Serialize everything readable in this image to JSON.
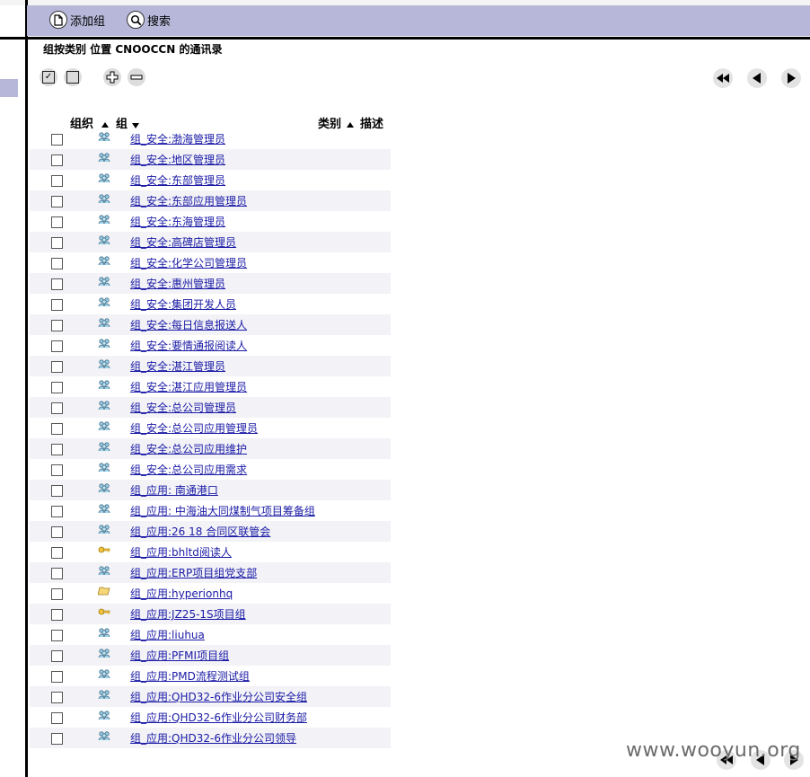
{
  "toolbar": {
    "add_group_label": "添加组",
    "search_label": "搜索"
  },
  "heading": "组按类别 位置 CNOOCCN 的通讯录",
  "columns": {
    "org": "组织",
    "group": "组",
    "category": "类别",
    "desc": "描述"
  },
  "rows": [
    {
      "label": "组_安全:渤海管理员",
      "icon": "group-icon"
    },
    {
      "label": "组_安全:地区管理员",
      "icon": "group-icon"
    },
    {
      "label": "组_安全:东部管理员",
      "icon": "group-icon"
    },
    {
      "label": "组_安全:东部应用管理员",
      "icon": "group-icon"
    },
    {
      "label": "组_安全:东海管理员",
      "icon": "group-icon"
    },
    {
      "label": "组_安全:高碑店管理员",
      "icon": "group-icon"
    },
    {
      "label": "组_安全:化学公司管理员",
      "icon": "group-icon"
    },
    {
      "label": "组_安全:惠州管理员",
      "icon": "group-icon"
    },
    {
      "label": "组_安全:集团开发人员",
      "icon": "group-icon"
    },
    {
      "label": "组_安全:每日信息报送人",
      "icon": "group-icon"
    },
    {
      "label": "组_安全:要情通报阅读人",
      "icon": "group-icon"
    },
    {
      "label": "组_安全:湛江管理员",
      "icon": "group-icon"
    },
    {
      "label": "组_安全:湛江应用管理员",
      "icon": "group-icon"
    },
    {
      "label": "组_安全:总公司管理员",
      "icon": "group-icon"
    },
    {
      "label": "组_安全:总公司应用管理员",
      "icon": "group-icon"
    },
    {
      "label": "组_安全:总公司应用维护",
      "icon": "group-icon"
    },
    {
      "label": "组_安全:总公司应用需求",
      "icon": "group-icon"
    },
    {
      "label": "组_应用: 南通港口",
      "icon": "group-icon"
    },
    {
      "label": "组_应用: 中海油大同煤制气项目筹备组",
      "icon": "group-icon"
    },
    {
      "label": "组_应用:26 18 合同区联管会",
      "icon": "group-icon"
    },
    {
      "label": "组_应用:bhltd阅读人",
      "icon": "key-icon"
    },
    {
      "label": "组_应用:ERP项目组党支部",
      "icon": "group-icon"
    },
    {
      "label": "组_应用:hyperionhq",
      "icon": "folder-icon"
    },
    {
      "label": "组_应用:JZ25-1S项目组",
      "icon": "key-icon"
    },
    {
      "label": "组_应用:liuhua",
      "icon": "group-icon"
    },
    {
      "label": "组_应用:PFMI项目组",
      "icon": "group-icon"
    },
    {
      "label": "组_应用:PMD流程测试组",
      "icon": "group-icon"
    },
    {
      "label": "组_应用:QHD32-6作业分公司安全组",
      "icon": "group-icon"
    },
    {
      "label": "组_应用:QHD32-6作业分公司财务部",
      "icon": "group-icon"
    },
    {
      "label": "组_应用:QHD32-6作业分公司领导",
      "icon": "group-icon"
    }
  ],
  "watermark": "www.wooyun.org",
  "colors": {
    "toolbar_bg": "#b7b8d9",
    "link": "#1a1aa6",
    "row_alt": "#f2f2f7"
  }
}
